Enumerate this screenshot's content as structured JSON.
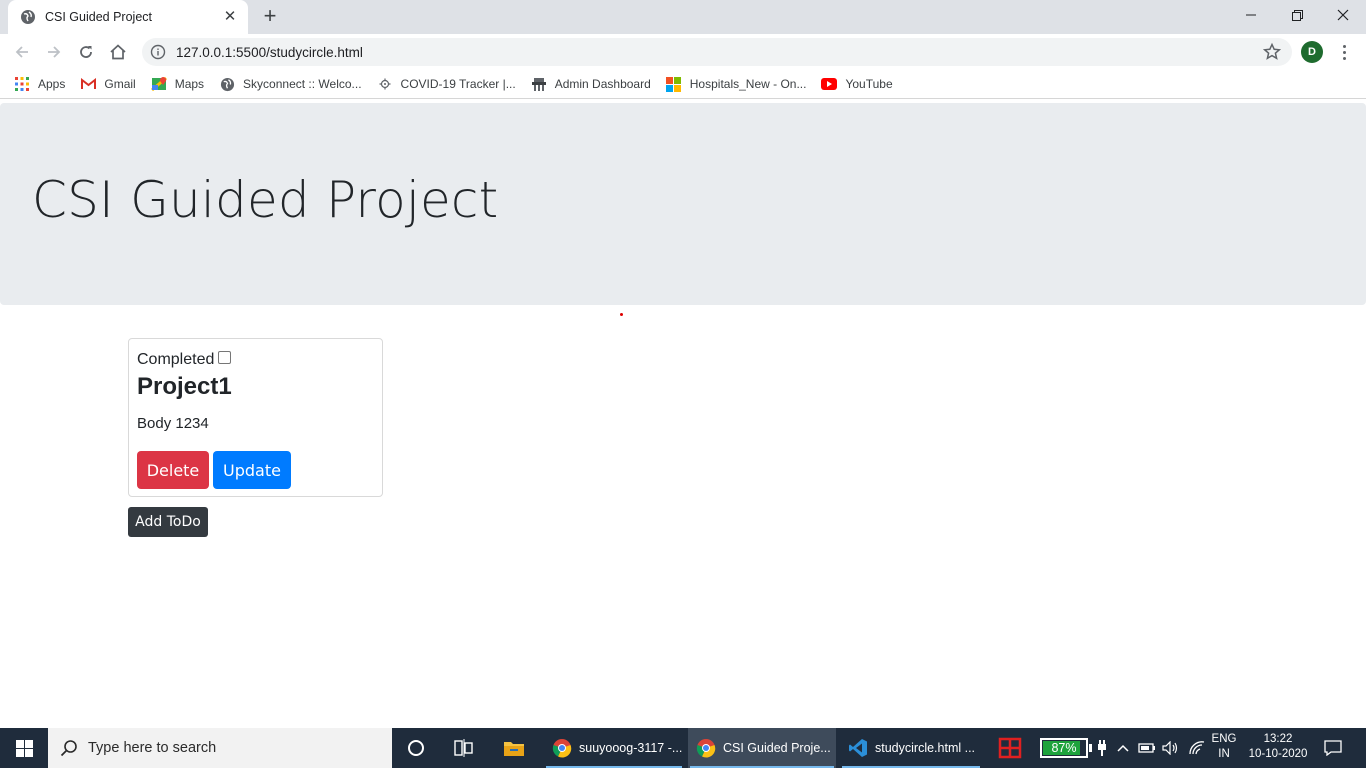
{
  "browser": {
    "tab_title": "CSI Guided Project",
    "tab_close": "✕",
    "new_tab": "+",
    "url": "127.0.0.1:5500/studycircle.html",
    "profile_initial": "D",
    "bookmarks": [
      {
        "label": "Apps",
        "icon": "apps-grid-icon"
      },
      {
        "label": "Gmail",
        "icon": "gmail-icon"
      },
      {
        "label": "Maps",
        "icon": "maps-icon"
      },
      {
        "label": "Skyconnect :: Welco...",
        "icon": "globe-icon"
      },
      {
        "label": "COVID-19 Tracker |...",
        "icon": "virus-icon"
      },
      {
        "label": "Admin Dashboard",
        "icon": "admin-icon"
      },
      {
        "label": "Hospitals_New - On...",
        "icon": "microsoft-icon"
      },
      {
        "label": "YouTube",
        "icon": "youtube-icon"
      }
    ]
  },
  "page": {
    "heading": "CSI Guided Project",
    "todo": {
      "completed_label": "Completed",
      "completed_checked": false,
      "title": "Project1",
      "body": "Body 1234",
      "delete_label": "Delete",
      "update_label": "Update"
    },
    "add_todo_label": "Add ToDo"
  },
  "taskbar": {
    "search_placeholder": "Type here to search",
    "apps": [
      {
        "label": "suuyooog-3117 -...",
        "icon": "chrome-icon",
        "active": false
      },
      {
        "label": "CSI Guided Proje...",
        "icon": "chrome-icon",
        "active": true
      },
      {
        "label": "studycircle.html ...",
        "icon": "vscode-icon",
        "active": false
      }
    ],
    "battery_percent": 87,
    "battery_label": "87%",
    "lang_line1": "ENG",
    "lang_line2": "IN",
    "time": "13:22",
    "date": "10-10-2020"
  },
  "colors": {
    "delete": "#dc3545",
    "update": "#007bff",
    "add": "#343a40",
    "jumbotron": "#e9ecef",
    "battery_fill": "#1ea33c"
  }
}
